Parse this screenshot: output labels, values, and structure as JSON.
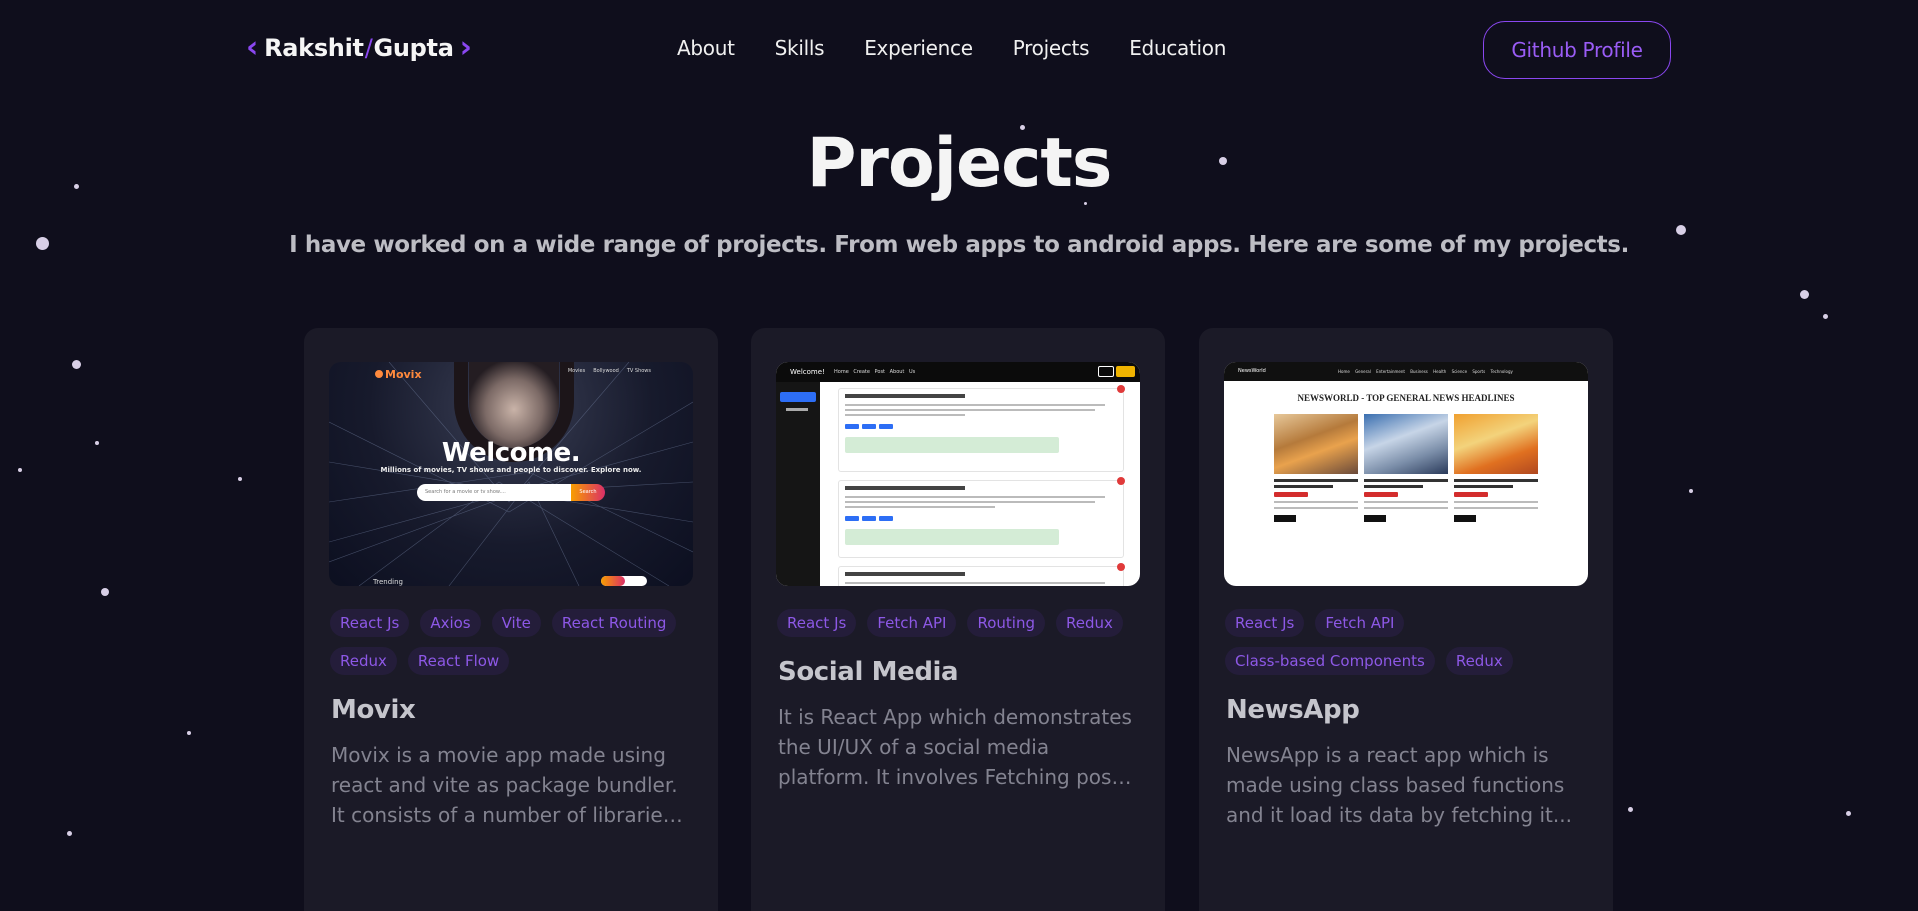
{
  "nav": {
    "logo_first": "Rakshit",
    "logo_slash": "/",
    "logo_last": "Gupta",
    "links": [
      "About",
      "Skills",
      "Experience",
      "Projects",
      "Education"
    ],
    "cta_label": "Github Profile"
  },
  "header": {
    "title": "Projects",
    "subtitle": "I have worked on a wide range of projects. From web apps to android apps. Here are some of my projects."
  },
  "projects": [
    {
      "title": "Movix",
      "tags": [
        "React Js",
        "Axios",
        "Vite",
        "React Routing",
        "Redux",
        "React Flow"
      ],
      "description_lines": [
        "Movix is a movie app made using",
        "react and vite as package bundler.",
        "It consists of a number of libraries..."
      ],
      "preview": {
        "brand": "Movix",
        "nav": [
          "Movies",
          "Bollywood",
          "TV Shows"
        ],
        "heading": "Welcome.",
        "tagline": "Millions of movies, TV shows and people to discover. Explore now.",
        "search_placeholder": "Search for a movie or tv show....",
        "search_button": "Search",
        "section": "Trending"
      }
    },
    {
      "title": "Social Media",
      "tags": [
        "React Js",
        "Fetch API",
        "Routing",
        "Redux"
      ],
      "description_lines": [
        "It is React App which demonstrates",
        "the UI/UX of a social media",
        "platform. It involves Fetching posts..."
      ],
      "preview": {
        "brand": "Welcome!",
        "nav": "Home  Create Post  About Us"
      }
    },
    {
      "title": "NewsApp",
      "tags": [
        "React Js",
        "Fetch API",
        "Class-based Components",
        "Redux"
      ],
      "description_lines": [
        "NewsApp is a react app which is",
        "made using class based functions",
        "and it load its data by fetching it..."
      ],
      "preview": {
        "brand": "NewsWorld",
        "nav": "Home General Entertainment Business Health Science Sports Technology",
        "headline": "NEWSWORLD - TOP GENERAL NEWS HEADLINES"
      }
    }
  ],
  "colors": {
    "background": "#0f0e1c",
    "card": "#1b1a27",
    "accent": "#8a47f0",
    "tag_bg": "#241d3a"
  }
}
